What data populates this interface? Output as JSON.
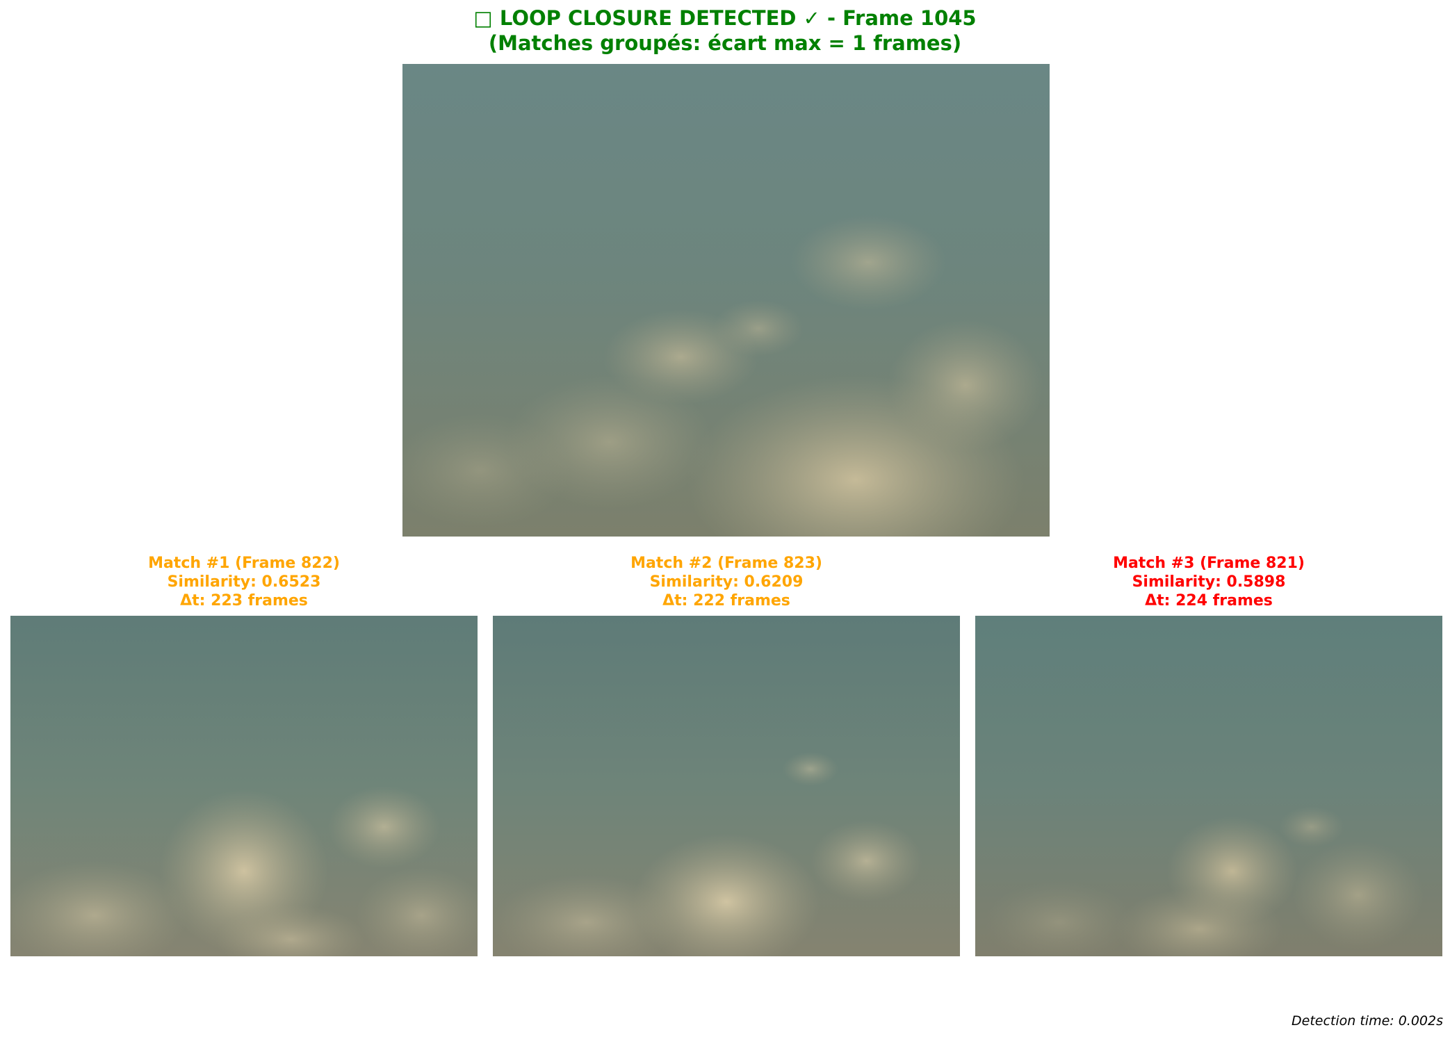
{
  "title": {
    "line1": "□ LOOP CLOSURE DETECTED ✓ - Frame 1045",
    "line2": "(Matches groupés: écart max = 1 frames)",
    "color": "#008000"
  },
  "query_image": {
    "frame": 1045,
    "description_icon": "underwater-seafloor-image"
  },
  "matches": [
    {
      "title": "Match #1 (Frame 822)",
      "similarity": "Similarity: 0.6523",
      "dt": "Δt: 223 frames",
      "color": "#FFA500"
    },
    {
      "title": "Match #2 (Frame 823)",
      "similarity": "Similarity: 0.6209",
      "dt": "Δt: 222 frames",
      "color": "#FFA500"
    },
    {
      "title": "Match #3 (Frame 821)",
      "similarity": "Similarity: 0.5898",
      "dt": "Δt: 224 frames",
      "color": "#FF0000"
    }
  ],
  "footer": {
    "detection_time": "Detection time: 0.002s"
  }
}
